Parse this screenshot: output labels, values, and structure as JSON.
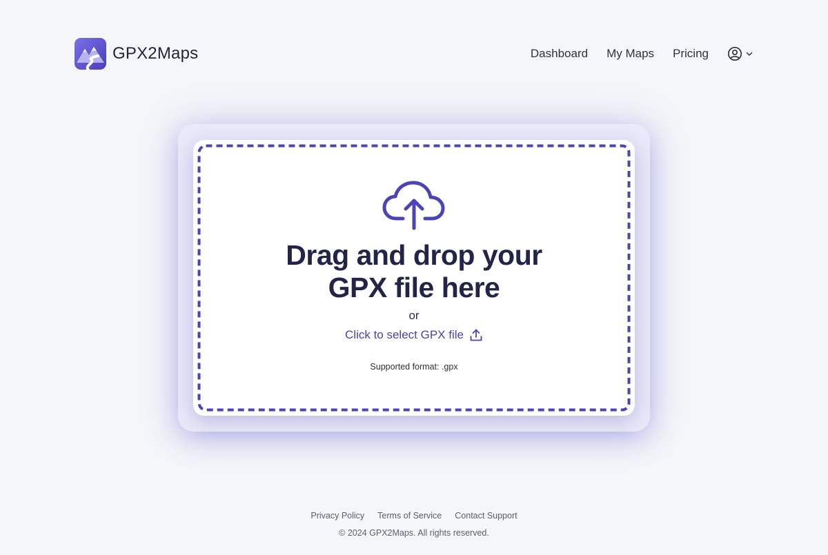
{
  "app": {
    "name": "GPX2Maps"
  },
  "nav": {
    "items": [
      {
        "label": "Dashboard"
      },
      {
        "label": "My Maps"
      },
      {
        "label": "Pricing"
      }
    ],
    "user_icon": "user-circle-icon",
    "chevron_icon": "chevron-down-icon"
  },
  "upload": {
    "icon": "cloud-upload-icon",
    "headline_line1": "Drag and drop your",
    "headline_line2": "GPX file here",
    "or": "or",
    "select_label": "Click to select GPX file",
    "select_icon": "upload-icon",
    "supported": "Supported format: .gpx"
  },
  "footer": {
    "links": [
      {
        "label": "Privacy Policy"
      },
      {
        "label": "Terms of Service"
      },
      {
        "label": "Contact Support"
      }
    ],
    "copyright": "© 2024 GPX2Maps. All rights reserved."
  },
  "colors": {
    "accent": "#4a44b8",
    "background": "#f4f6f9",
    "text_dark": "#22244a"
  }
}
